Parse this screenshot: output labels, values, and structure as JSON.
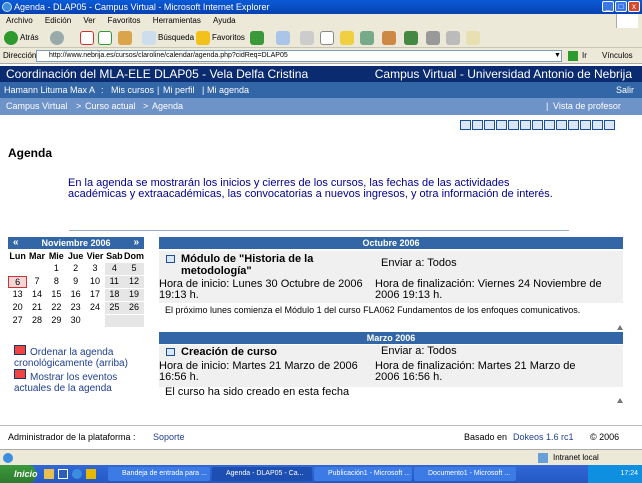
{
  "window": {
    "title": "Agenda - DLAP05 - Campus Virtual - Microsoft Internet Explorer"
  },
  "menu": [
    "Archivo",
    "Edición",
    "Ver",
    "Favoritos",
    "Herramientas",
    "Ayuda"
  ],
  "toolbar": {
    "back": "Atrás",
    "search": "Búsqueda",
    "favorites": "Favoritos"
  },
  "address": {
    "label": "Dirección",
    "url": "http://www.nebrija.es/cursos/claroline/calendar/agenda.php?cidReq=DLAP05",
    "go": "Ir",
    "links": "Vínculos"
  },
  "header": {
    "left": "Coordinación del MLA-ELE DLAP05 - Vela Delfa Cristina",
    "right": "Campus Virtual - Universidad Antonio de Nebrija"
  },
  "userbar": {
    "user": "Hamann Lituma Max A",
    "mis_cursos": "Mis cursos",
    "mi_perfil": "Mi perfil",
    "mi_agenda": "Mi agenda",
    "salir": "Salir"
  },
  "breadcrumb": {
    "campus": "Campus Virtual",
    "curso": "Curso actual",
    "agenda": "Agenda",
    "vista": "Vista de profesor"
  },
  "page": {
    "title": "Agenda",
    "intro": "En la agenda se mostrarán los inicios y cierres de los cursos, las fechas de las actividades académicas y extraacadémicas, las convocatorias a nuevos ingresos, y otra información de interés."
  },
  "calendar": {
    "month": "Noviembre 2006",
    "prev": "«",
    "next": "»",
    "days": [
      "Lun",
      "Mar",
      "Mie",
      "Jue",
      "Vier",
      "Sab",
      "Dom"
    ],
    "weeks": [
      [
        "",
        "",
        "1",
        "2",
        "3",
        "4",
        "5"
      ],
      [
        "6",
        "7",
        "8",
        "9",
        "10",
        "11",
        "12"
      ],
      [
        "13",
        "14",
        "15",
        "16",
        "17",
        "18",
        "19"
      ],
      [
        "20",
        "21",
        "22",
        "23",
        "24",
        "25",
        "26"
      ],
      [
        "27",
        "28",
        "29",
        "30",
        "",
        "",
        ""
      ]
    ],
    "today": "6"
  },
  "sidebar": {
    "order_link": "Ordenar la agenda cronológicamente (arriba)",
    "current_link": "Mostrar los eventos actuales de la agenda"
  },
  "events": [
    {
      "month": "Octubre 2006",
      "title": "Módulo de \"Historia de la metodología\"",
      "send_to": "Enviar a: Todos",
      "start": "Hora de inicio: Lunes 30 Octubre de 2006   19:13 h.",
      "end": "Hora de finalización: Viernes 24 Noviembre de 2006   19:13 h.",
      "description": "El próximo lunes comienza el Módulo 1 del curso FLA062 Fundamentos de los enfoques comunicativos."
    },
    {
      "month": "Marzo 2006",
      "title": "Creación de curso",
      "send_to": "Enviar a: Todos",
      "start": "Hora de inicio: Martes 21 Marzo de 2006   16:56 h.",
      "end": "Hora de finalización: Martes 21 Marzo de 2006   16:56 h.",
      "description": "El curso ha sido creado en esta fecha"
    }
  ],
  "footer": {
    "admin_label": "Administrador de la plataforma :",
    "admin_link": "Soporte",
    "based_on": "Basado en",
    "dokeos": "Dokeos 1.6 rc1",
    "year": "© 2006"
  },
  "status": {
    "zone": "Intranet local"
  },
  "taskbar": {
    "start": "Inicio",
    "tasks": [
      "Bandeja de entrada para ...",
      "Agenda - DLAP05 - Ca...",
      "Publicación1 - Microsoft ...",
      "Documento1 - Microsoft ..."
    ],
    "clock": "17:24"
  }
}
